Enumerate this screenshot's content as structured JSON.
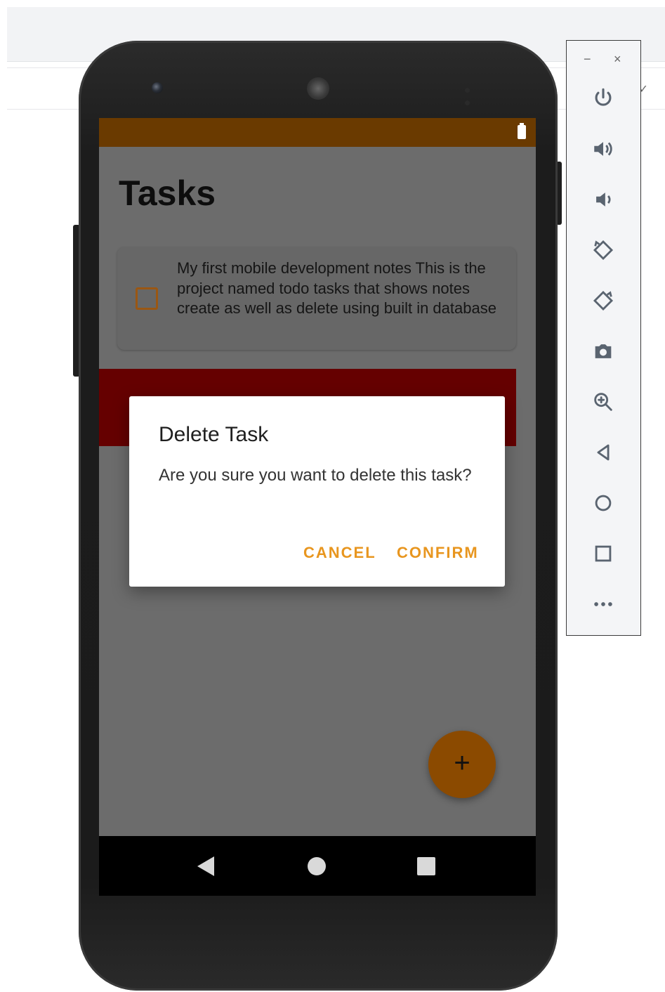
{
  "app": {
    "title": "Tasks"
  },
  "task": {
    "checked": false,
    "text": "My first mobile development notes This is the project named todo tasks that shows notes create as well as delete using built in database"
  },
  "dialog": {
    "title": "Delete Task",
    "message": "Are you sure you want to delete this task?",
    "cancel_label": "CANCEL",
    "confirm_label": "CONFIRM"
  },
  "fab": {
    "label": "+"
  },
  "emulator_controls": {
    "window_min": "−",
    "window_close": "×",
    "buttons": [
      {
        "icon": "power-icon"
      },
      {
        "icon": "volume-up-icon"
      },
      {
        "icon": "volume-down-icon"
      },
      {
        "icon": "rotate-left-icon"
      },
      {
        "icon": "rotate-right-icon"
      },
      {
        "icon": "camera-icon"
      },
      {
        "icon": "zoom-icon"
      },
      {
        "icon": "back-icon"
      },
      {
        "icon": "home-icon"
      },
      {
        "icon": "overview-icon"
      },
      {
        "icon": "more-icon"
      }
    ]
  },
  "colors": {
    "status_bar": "#6a3a00",
    "swipe_delete_bg": "#650000",
    "accent": "#e8961f",
    "fab": "#8b4a00",
    "scrim_bg": "#6c6c6c"
  }
}
